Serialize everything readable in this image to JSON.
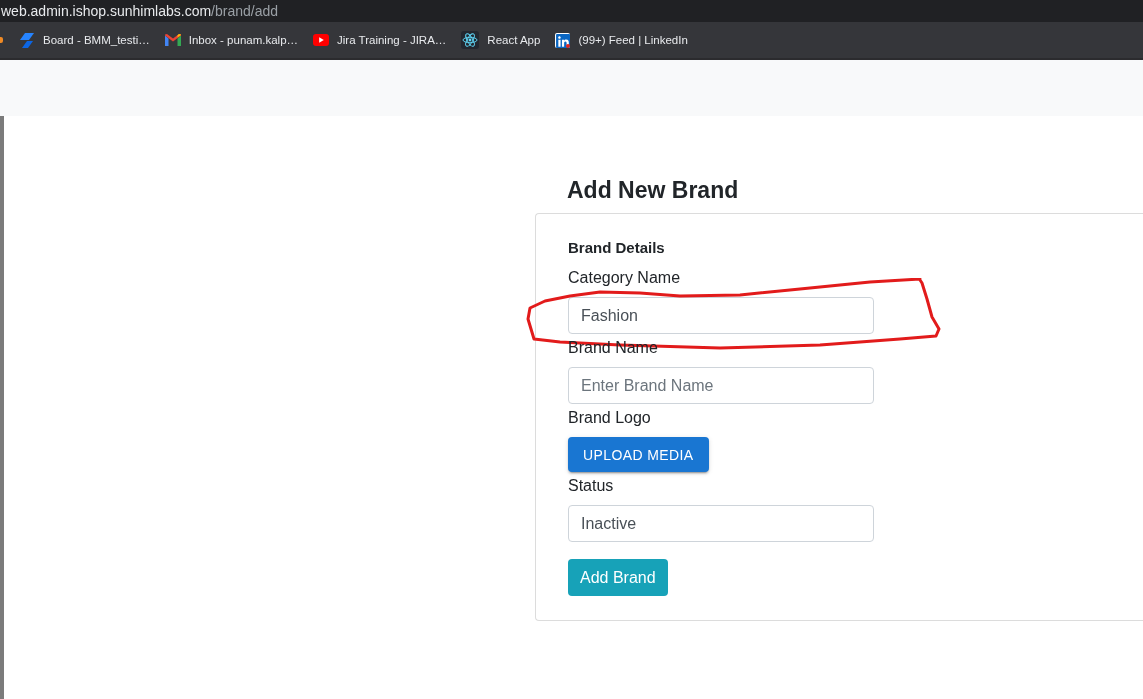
{
  "browser": {
    "address": {
      "host": "web.admin.ishop.sunhimlabs.com",
      "path": "/brand/add"
    },
    "bookmarks": [
      {
        "kind": "board",
        "label": "Board - BMM_testi…"
      },
      {
        "kind": "mail",
        "label": "Inbox - punam.kalp…"
      },
      {
        "kind": "video",
        "label": "Jira Training - JIRA…"
      },
      {
        "kind": "atom",
        "label": "React App"
      },
      {
        "kind": "network",
        "label": "(99+) Feed | LinkedIn"
      }
    ]
  },
  "page": {
    "title": "Add New Brand",
    "form": {
      "section_title": "Brand Details",
      "fields": [
        {
          "kind": "input",
          "label": "Category Name",
          "value": "Fashion"
        },
        {
          "kind": "input",
          "label": "Brand Name",
          "placeholder": "Enter Brand Name"
        },
        {
          "kind": "upload",
          "label": "Brand Logo",
          "button": "UPLOAD MEDIA"
        },
        {
          "kind": "input",
          "label": "Status",
          "value": "Inactive"
        }
      ],
      "submit": "Add Brand"
    }
  }
}
